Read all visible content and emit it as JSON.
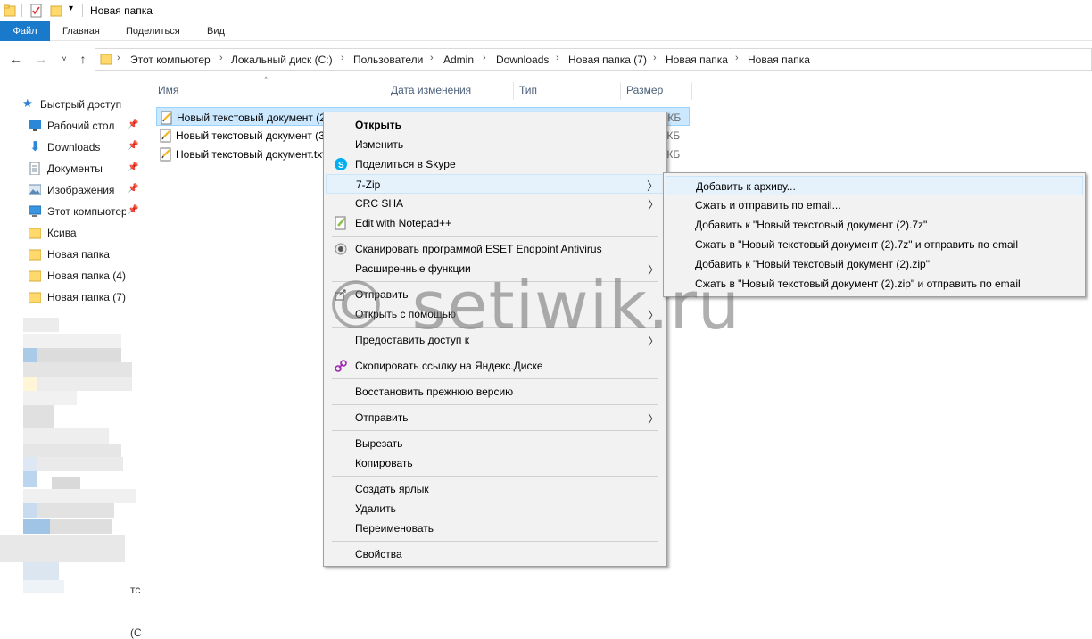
{
  "window": {
    "title": "Новая папка"
  },
  "ribbon": {
    "tabs": [
      "Файл",
      "Главная",
      "Поделиться",
      "Вид"
    ]
  },
  "address": {
    "crumbs": [
      "Этот компьютер",
      "Локальный диск (C:)",
      "Пользователи",
      "Admin",
      "Downloads",
      "Новая папка (7)",
      "Новая папка",
      "Новая папка"
    ]
  },
  "sidebar": {
    "quick_access": "Быстрый доступ",
    "items": [
      {
        "label": "Рабочий стол",
        "icon": "desktop-icon",
        "pinned": true
      },
      {
        "label": "Downloads",
        "icon": "download-icon",
        "pinned": true
      },
      {
        "label": "Документы",
        "icon": "documents-icon",
        "pinned": true
      },
      {
        "label": "Изображения",
        "icon": "pictures-icon",
        "pinned": true
      },
      {
        "label": "Этот компьютер",
        "icon": "computer-icon",
        "pinned": true
      },
      {
        "label": "Ксива",
        "icon": "folder-icon",
        "pinned": false
      },
      {
        "label": "Новая папка",
        "icon": "folder-icon",
        "pinned": false
      },
      {
        "label": "Новая папка (4)",
        "icon": "folder-icon",
        "pinned": false
      },
      {
        "label": "Новая папка (7)",
        "icon": "folder-icon",
        "pinned": false
      }
    ],
    "partial_text_1": "тс",
    "partial_text_2": "(C"
  },
  "filelist": {
    "columns": [
      "Имя",
      "Дата изменения",
      "Тип",
      "Размер"
    ],
    "files": [
      {
        "name": "Новый текстовый документ (2",
        "size": ") КБ",
        "selected": true
      },
      {
        "name": "Новый текстовый документ (3",
        "size": ") КБ",
        "selected": false
      },
      {
        "name": "Новый текстовый документ.txt",
        "size": ") КБ",
        "selected": false
      }
    ]
  },
  "context_menu": {
    "groups": [
      [
        {
          "label": "Открыть",
          "bold": true
        },
        {
          "label": "Изменить"
        },
        {
          "label": "Поделиться в Skype",
          "icon": "skype-icon"
        },
        {
          "label": "7-Zip",
          "submenu": true,
          "highlighted": true
        },
        {
          "label": "CRC SHA",
          "submenu": true
        },
        {
          "label": "Edit with Notepad++",
          "icon": "notepadpp-icon"
        }
      ],
      [
        {
          "label": "Сканировать программой ESET Endpoint Antivirus",
          "icon": "eset-icon"
        },
        {
          "label": "Расширенные функции",
          "submenu": true
        }
      ],
      [
        {
          "label": "Отправить",
          "icon": "share-icon"
        },
        {
          "label": "Открыть с помощью",
          "submenu": true
        }
      ],
      [
        {
          "label": "Предоставить доступ к",
          "submenu": true
        }
      ],
      [
        {
          "label": "Скопировать ссылку на Яндекс.Диске",
          "icon": "yandex-disk-icon"
        }
      ],
      [
        {
          "label": "Восстановить прежнюю версию"
        }
      ],
      [
        {
          "label": "Отправить",
          "submenu": true
        }
      ],
      [
        {
          "label": "Вырезать"
        },
        {
          "label": "Копировать"
        }
      ],
      [
        {
          "label": "Создать ярлык"
        },
        {
          "label": "Удалить"
        },
        {
          "label": "Переименовать"
        }
      ],
      [
        {
          "label": "Свойства"
        }
      ]
    ]
  },
  "zip_submenu": {
    "items": [
      "Добавить к архиву...",
      "Сжать и отправить по email...",
      "Добавить к \"Новый текстовый документ (2).7z\"",
      "Сжать в \"Новый текстовый документ (2).7z\" и отправить по email",
      "Добавить к \"Новый текстовый документ (2).zip\"",
      "Сжать в \"Новый текстовый документ (2).zip\" и отправить по email"
    ]
  },
  "watermark": "© setiwik.ru",
  "colors": {
    "accent": "#1979ca",
    "selection": "#cce8ff",
    "menu_bg": "#f2f2f2",
    "folder": "#ffd96b"
  }
}
